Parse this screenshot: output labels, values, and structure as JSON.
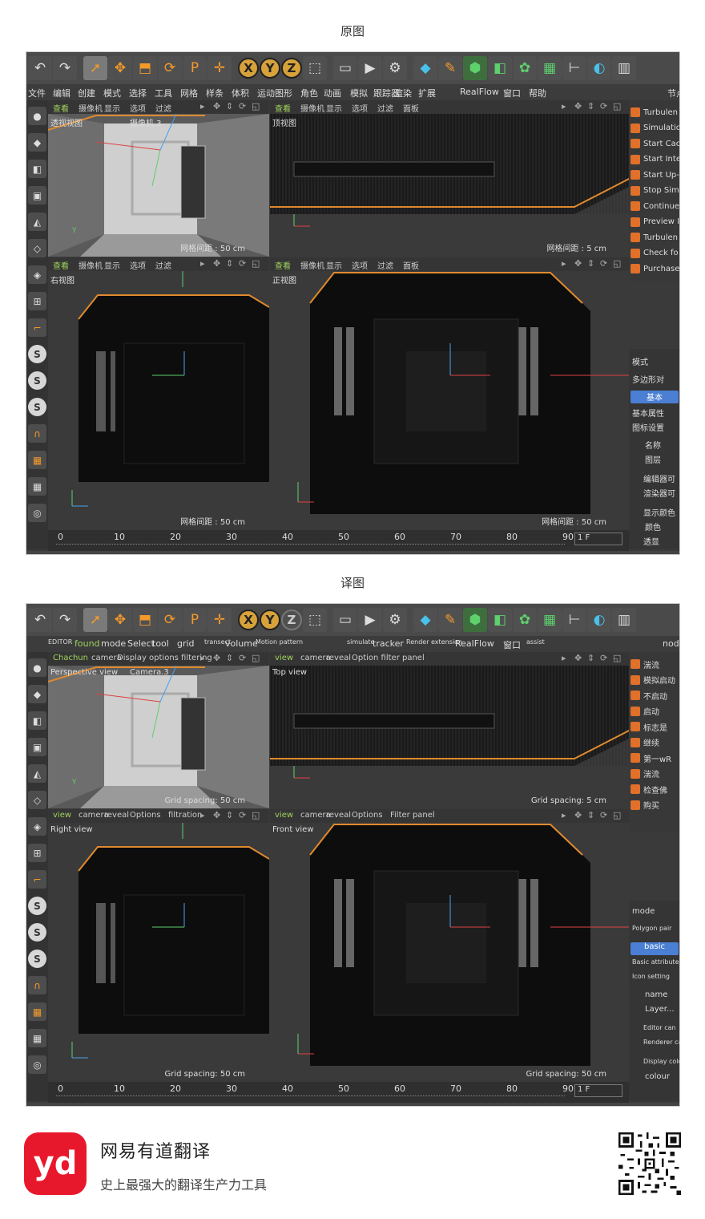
{
  "captions": {
    "original": "原图",
    "translated": "译图"
  },
  "shots": [
    {
      "key": "orig",
      "menu": [
        "文件",
        "编辑",
        "创建",
        "模式",
        "选择",
        "工具",
        "网格",
        "样条",
        "体积",
        "运动图形",
        "角色",
        "动画",
        "模拟",
        "跟踪器",
        "渲染",
        "扩展",
        "RealFlow",
        "窗口",
        "帮助",
        "节点"
      ],
      "vp_headers": {
        "tl": [
          "查看",
          "摄像机",
          "显示",
          "选项",
          "过滤"
        ],
        "tr": [
          "查看",
          "摄像机",
          "显示",
          "选项",
          "过滤",
          "面板"
        ],
        "bl": [
          "查看",
          "摄像机",
          "显示",
          "选项",
          "过滤"
        ],
        "br": [
          "查看",
          "摄像机",
          "显示",
          "选项",
          "过滤",
          "面板"
        ]
      },
      "vp_labels": {
        "persp": "透视视图",
        "camera": "摄像机.3",
        "top": "顶视图",
        "right": "右视图",
        "front": "正视图"
      },
      "grid": {
        "persp": "网格间距 : 50 cm",
        "top": "网格间距 : 5 cm",
        "right": "网格间距 : 50 cm",
        "front": "网格间距 : 50 cm"
      },
      "right_items": [
        "Turbulen",
        "Simulatic",
        "Start Cac",
        "Start Inte",
        "Start Up-",
        "Stop Sim",
        "Continue",
        "Preview I",
        "Turbulen",
        "Check fo",
        "Purchase"
      ],
      "attr": {
        "mode": "模式",
        "obj": "多边形对",
        "basic_tab": "基本",
        "basic_attr": "基本属性",
        "icon_setting": "图标设置",
        "name": "名称",
        "layer": "图层",
        "editor": "编辑器可",
        "renderer": "渲染器可",
        "display_color": "显示颜色",
        "color": "颜色",
        "transparent": "透显"
      }
    },
    {
      "key": "trans",
      "menu": [
        "EDITOR",
        "found",
        "mode",
        "Select",
        "tool",
        "grid",
        "transect",
        "volume",
        "Motion pattern",
        "simulate",
        "tracker",
        "Render extension",
        "RealFlow",
        "窗口",
        "assist",
        "node"
      ],
      "vp_headers": {
        "tl": [
          "Chachun",
          "camera",
          "Display options filtering"
        ],
        "tr": [
          "view",
          "camera",
          "reveal",
          "Option filter panel"
        ],
        "bl": [
          "view",
          "camera",
          "reveal",
          "Options",
          "filtration"
        ],
        "br": [
          "view",
          "camera",
          "reveal",
          "Options",
          "Filter panel"
        ]
      },
      "vp_labels": {
        "persp": "Perspective view",
        "camera": "Camera.3",
        "top": "Top view",
        "right": "Right view",
        "front": "Front view"
      },
      "grid": {
        "persp": "Grid spacing: 50 cm",
        "top": "Grid spacing: 5 cm",
        "right": "Grid spacing: 50 cm",
        "front": "Grid spacing: 50 cm"
      },
      "right_items": [
        "湍流",
        "模拟启动",
        "不启动",
        "启动",
        "标志是",
        "继续",
        "第一wR",
        "湍流",
        "检查佛",
        "购买"
      ],
      "attr": {
        "mode": "mode",
        "obj": "Polygon pair",
        "basic_tab": "basic",
        "basic_attr": "Basic attribute",
        "icon_setting": "Icon setting",
        "name": "name",
        "layer": "Layer...",
        "editor": "Editor can",
        "renderer": "Renderer can",
        "display_color": "Display color",
        "color": "colour",
        "transparent": ""
      }
    }
  ],
  "timeline": {
    "ticks": [
      "0",
      "10",
      "20",
      "30",
      "40",
      "50",
      "60",
      "70",
      "80",
      "90"
    ],
    "frame": "1 F"
  },
  "footer": {
    "logo": "yd",
    "brand": "网易有道翻译",
    "slogan": "史上最强大的翻译生产力工具"
  }
}
